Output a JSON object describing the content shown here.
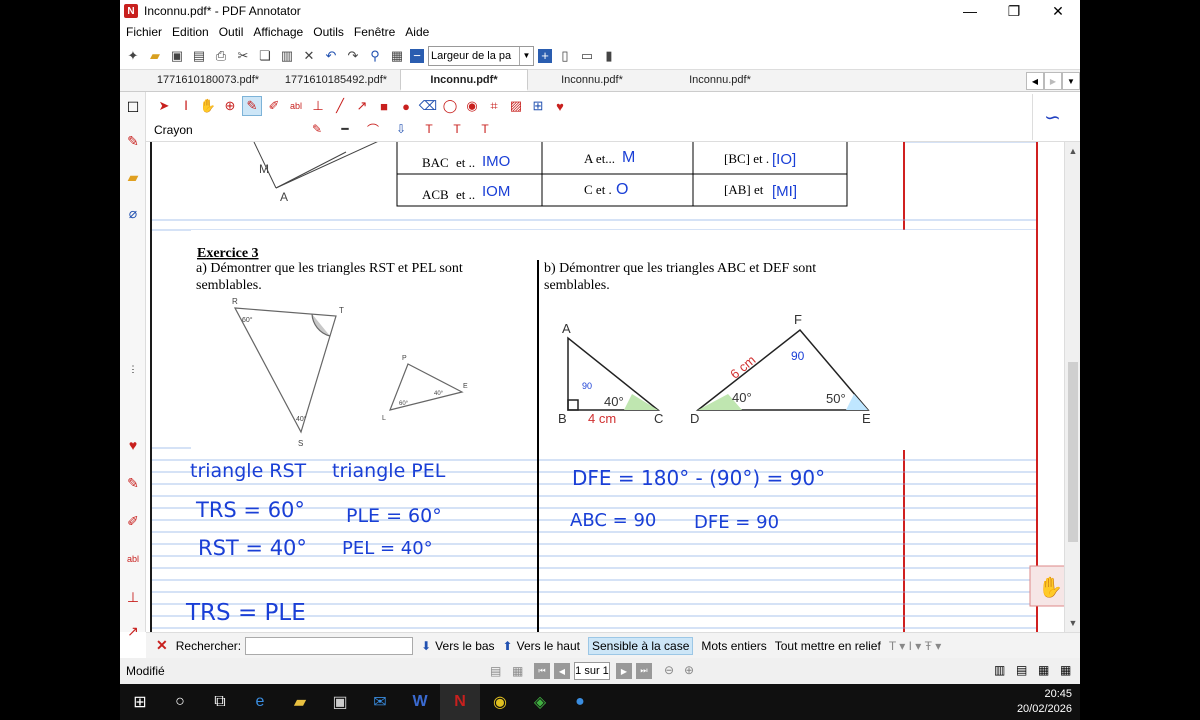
{
  "window": {
    "title": "Inconnu.pdf* - PDF Annotator",
    "app_icon": "N",
    "controls": [
      "—",
      "❐",
      "✕"
    ]
  },
  "menu": [
    "Fichier",
    "Edition",
    "Outil",
    "Affichage",
    "Outils",
    "Fenêtre",
    "Aide"
  ],
  "toolbar": {
    "zoom_value": "Largeur de la pa"
  },
  "tabs": [
    "1771610180073.pdf*",
    "1771610185492.pdf*",
    "Inconnu.pdf*",
    "Inconnu.pdf*",
    "Inconnu.pdf*"
  ],
  "active_tab_index": 2,
  "tools": {
    "current_tool": "Crayon"
  },
  "document": {
    "table": [
      {
        "angle": "BAC",
        "angle_suffix": " et ..",
        "angle_answer": "IMO",
        "vertex": "A et...",
        "vertex_answer": "M",
        "side": "[BC] et .",
        "side_answer": "[IO]"
      },
      {
        "angle": "ACB",
        "angle_suffix": " et ..",
        "angle_answer": "IOM",
        "vertex": "C et .",
        "vertex_answer": "O",
        "side": "[AB] et ",
        "side_answer": "[MI]"
      }
    ],
    "top_labels": {
      "M": "M",
      "A": "A"
    },
    "exercise_title": "Exercice 3",
    "part_a": "a) Démontrer que les triangles RST et PEL sont semblables.",
    "part_b": "b) Démontrer que les triangles ABC et DEF sont semblables.",
    "tri_rst": {
      "R": "R",
      "T": "T",
      "S": "S",
      "angle_r": "60°",
      "angle_s": "40°"
    },
    "tri_pel": {
      "P": "P",
      "E": "E",
      "L": "L",
      "angle_l": "60°",
      "angle_e": "40°"
    },
    "tri_abc": {
      "A": "A",
      "B": "B",
      "C": "C",
      "angle_c": "40°",
      "side_bc": "4 cm",
      "hand_angle_b": "90"
    },
    "tri_def": {
      "D": "D",
      "E": "E",
      "F": "F",
      "angle_d": "40°",
      "angle_e": "50°",
      "side_df": "6 cm",
      "hand_angle_f": "90"
    },
    "handwriting": {
      "l1a": "triangle RST",
      "l1b": "triangle PEL",
      "l2a": "TRS = 60°",
      "l2b": "PLE = 60°",
      "l3a": "RST = 40°",
      "l3b": "PEL = 40°",
      "l4": "TRS = PLE",
      "r1": "DFE = 180° - (90°) = 90°",
      "r2a": "ABC = 90",
      "r2b": "DFE = 90"
    }
  },
  "search": {
    "label": "Rechercher:",
    "value": "",
    "down": "Vers le bas",
    "up": "Vers le haut",
    "case": "Sensible à la case",
    "whole": "Mots entiers",
    "highlight": "Tout mettre en relief"
  },
  "status": {
    "text": "Modifié",
    "page": "1 sur 1"
  },
  "taskbar": {
    "time": "20:45",
    "date": "20/02/2026"
  },
  "colors": {
    "accent": "#c8201e",
    "ink": "#1a3fd6",
    "grid_blue": "#8fb0e8",
    "margin_red": "#e23030"
  }
}
